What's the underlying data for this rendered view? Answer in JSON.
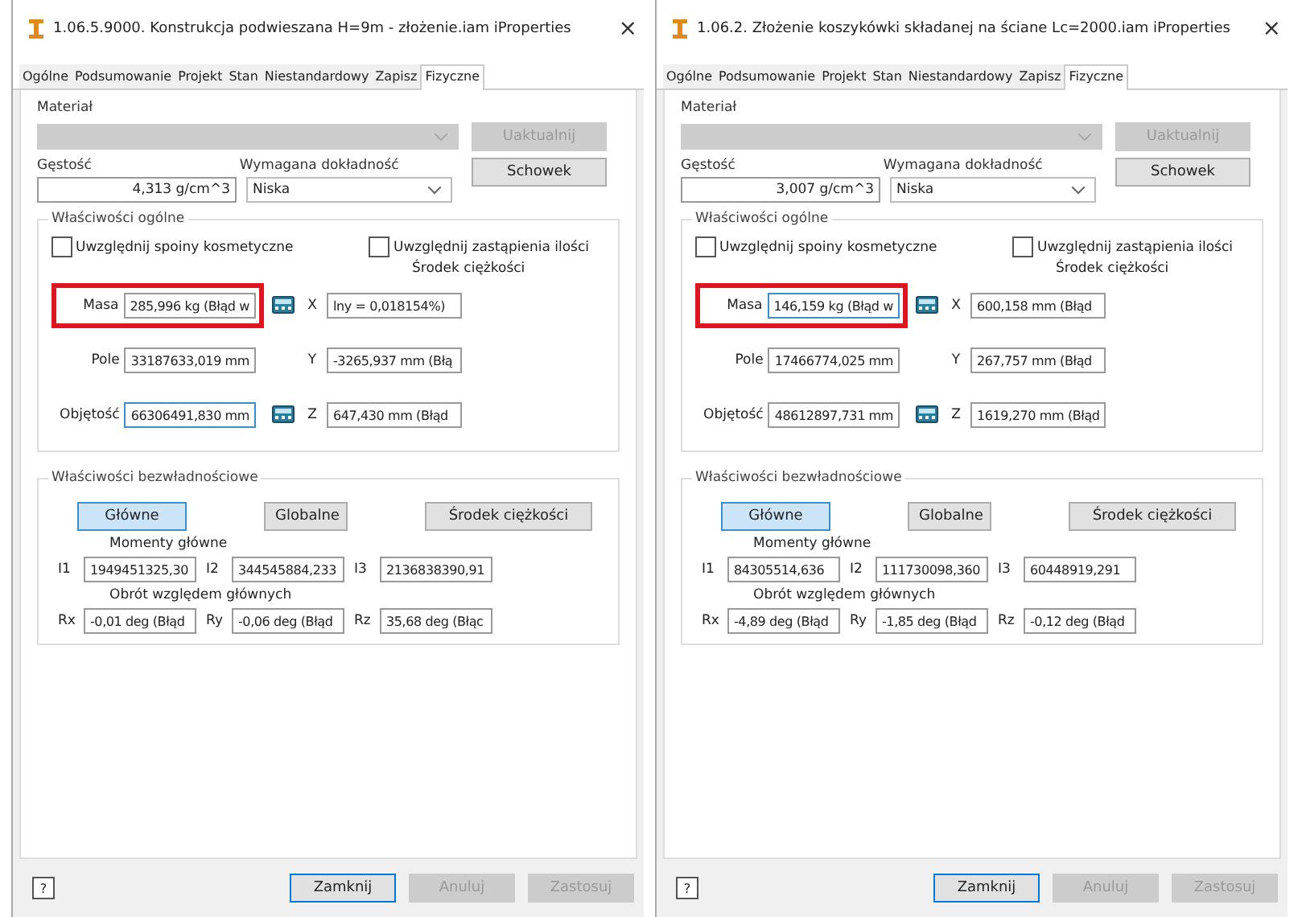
{
  "windows": [
    {
      "title": "1.06.5.9000. Konstrukcja podwieszana H=9m - złożenie.iam iProperties",
      "close": "×",
      "tabs": [
        {
          "label": "Ogólne",
          "selected": false
        },
        {
          "label": "Podsumowanie",
          "selected": false
        },
        {
          "label": "Projekt",
          "selected": false
        },
        {
          "label": "Stan",
          "selected": false
        },
        {
          "label": "Niestandardowy",
          "selected": false
        },
        {
          "label": "Zapisz",
          "selected": false
        },
        {
          "label": "Fizyczne",
          "selected": true
        }
      ],
      "material_label": "Materiał",
      "update_button": {
        "label": "Uaktualnij",
        "disabled": true
      },
      "density_label": "Gęstość",
      "density_value": "4,313 g/cm^3",
      "accuracy_label": "Wymagana dokładność",
      "accuracy_value": "Niska",
      "clipboard_button": "Schowek",
      "general": {
        "title": "Właściwości ogólne",
        "checkboxes": [
          {
            "label": "Uwzględnij spoiny kosmetyczne",
            "checked": false
          },
          {
            "label": "Uwzględnij zastąpienia ilości",
            "checked": false
          }
        ],
        "center_label": "Środek ciężkości",
        "rows": [
          {
            "label": "Masa",
            "value": "285,996 kg (Błąd w",
            "highlighted": true,
            "focused": false,
            "calculator": true,
            "axis": "X",
            "center_value": "lny = 0,018154%)"
          },
          {
            "label": "Pole",
            "value": "33187633,019 mm",
            "highlighted": false,
            "focused": false,
            "calculator": false,
            "axis": "Y",
            "center_value": "-3265,937 mm (Błą"
          },
          {
            "label": "Objętość",
            "value": "66306491,830 mm",
            "highlighted": false,
            "focused": true,
            "calculator": true,
            "axis": "Z",
            "center_value": "647,430 mm (Błąd"
          }
        ]
      },
      "inertia": {
        "title": "Właściwości bezwładnościowe",
        "buttons": [
          {
            "label": "Główne",
            "selected": true
          },
          {
            "label": "Globalne",
            "selected": false
          },
          {
            "label": "Środek ciężkości",
            "selected": false
          }
        ],
        "moments_label": "Momenty główne",
        "moments": [
          {
            "label": "I1",
            "value": "1949451325,30"
          },
          {
            "label": "I2",
            "value": "344545884,233"
          },
          {
            "label": "I3",
            "value": "2136838390,91"
          }
        ],
        "rotation_label": "Obrót względem głównych",
        "rotations": [
          {
            "label": "Rx",
            "value": "-0,01 deg (Błąd"
          },
          {
            "label": "Ry",
            "value": "-0,06 deg (Błąd"
          },
          {
            "label": "Rz",
            "value": "35,68 deg (Błąc"
          }
        ]
      },
      "help": "?",
      "footer_buttons": [
        {
          "label": "Zamknij",
          "disabled": false
        },
        {
          "label": "Anuluj",
          "disabled": true
        },
        {
          "label": "Zastosuj",
          "disabled": true
        }
      ]
    },
    {
      "title": "1.06.2. Złożenie koszykówki składanej na ściane Lc=2000.iam iProperties",
      "close": "×",
      "tabs": [
        {
          "label": "Ogólne",
          "selected": false
        },
        {
          "label": "Podsumowanie",
          "selected": false
        },
        {
          "label": "Projekt",
          "selected": false
        },
        {
          "label": "Stan",
          "selected": false
        },
        {
          "label": "Niestandardowy",
          "selected": false
        },
        {
          "label": "Zapisz",
          "selected": false
        },
        {
          "label": "Fizyczne",
          "selected": true
        }
      ],
      "material_label": "Materiał",
      "update_button": {
        "label": "Uaktualnij",
        "disabled": true
      },
      "density_label": "Gęstość",
      "density_value": "3,007 g/cm^3",
      "accuracy_label": "Wymagana dokładność",
      "accuracy_value": "Niska",
      "clipboard_button": "Schowek",
      "general": {
        "title": "Właściwości ogólne",
        "checkboxes": [
          {
            "label": "Uwzględnij spoiny kosmetyczne",
            "checked": false
          },
          {
            "label": "Uwzględnij zastąpienia ilości",
            "checked": false
          }
        ],
        "center_label": "Środek ciężkości",
        "rows": [
          {
            "label": "Masa",
            "value": "146,159 kg (Błąd w",
            "highlighted": true,
            "focused": true,
            "calculator": true,
            "axis": "X",
            "center_value": "600,158 mm (Błąd"
          },
          {
            "label": "Pole",
            "value": "17466774,025 mm",
            "highlighted": false,
            "focused": false,
            "calculator": false,
            "axis": "Y",
            "center_value": "267,757 mm (Błąd"
          },
          {
            "label": "Objętość",
            "value": "48612897,731 mm",
            "highlighted": false,
            "focused": false,
            "calculator": true,
            "axis": "Z",
            "center_value": "1619,270 mm (Błąd"
          }
        ]
      },
      "inertia": {
        "title": "Właściwości bezwładnościowe",
        "buttons": [
          {
            "label": "Główne",
            "selected": true
          },
          {
            "label": "Globalne",
            "selected": false
          },
          {
            "label": "Środek ciężkości",
            "selected": false
          }
        ],
        "moments_label": "Momenty główne",
        "moments": [
          {
            "label": "I1",
            "value": "84305514,636"
          },
          {
            "label": "I2",
            "value": "111730098,360"
          },
          {
            "label": "I3",
            "value": "60448919,291"
          }
        ],
        "rotation_label": "Obrót względem głównych",
        "rotations": [
          {
            "label": "Rx",
            "value": "-4,89 deg (Błąd"
          },
          {
            "label": "Ry",
            "value": "-1,85 deg (Błąd"
          },
          {
            "label": "Rz",
            "value": "-0,12 deg (Błąd"
          }
        ]
      },
      "help": "?",
      "footer_buttons": [
        {
          "label": "Zamknij",
          "disabled": false
        },
        {
          "label": "Anuluj",
          "disabled": true
        },
        {
          "label": "Zastosuj",
          "disabled": true
        }
      ]
    }
  ]
}
